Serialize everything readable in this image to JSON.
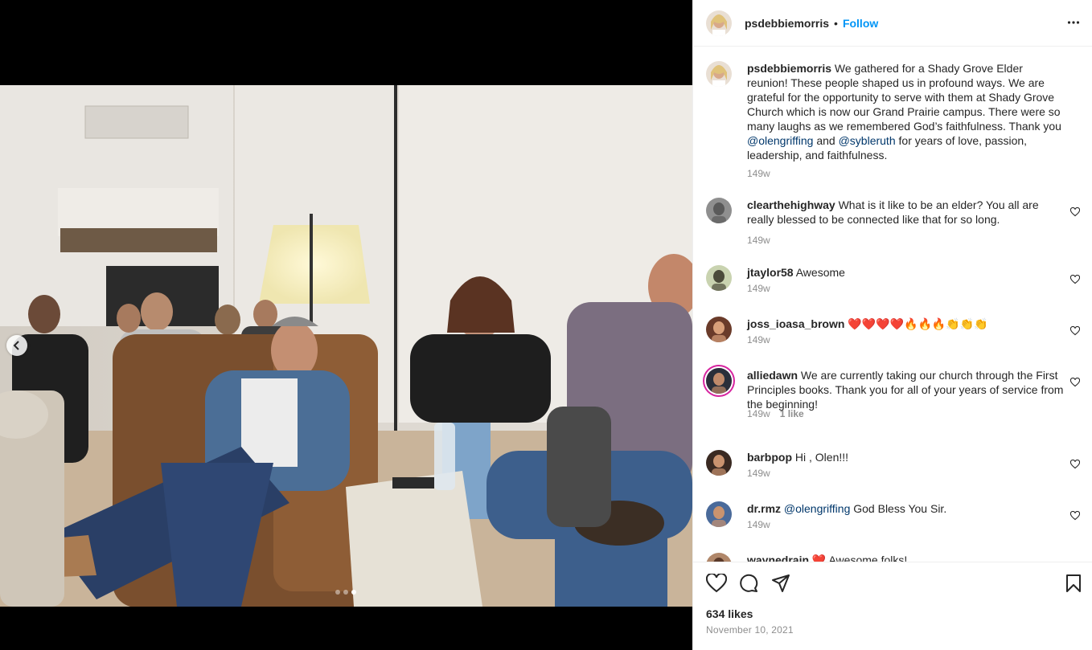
{
  "post": {
    "author": "psdebbiemorris",
    "follow_label": "Follow",
    "separator": "•",
    "caption": "We gathered for a Shady Grove Elder reunion! These people shaped us in profound ways. We are grateful for the opportunity to serve with them at Shady Grove Church which is now our Grand Prairie campus. There were so many laughs as we remembered God’s faithfulness. Thank you",
    "caption_mention_1": "@olengriffing",
    "caption_and": "and",
    "caption_mention_2": "@sybleruth",
    "caption_end": "for years of love, passion, leadership, and faithfulness.",
    "caption_time": "149w",
    "likes": "634 likes",
    "date": "November 10, 2021"
  },
  "carousel": {
    "total": 3,
    "active": 3
  },
  "comments": [
    {
      "user": "clearthehighway",
      "text": "What is it like to be an elder? You all are really blessed to be connected like that for so long.",
      "time": "149w"
    },
    {
      "user": "jtaylor58",
      "text": "Awesome",
      "time": "149w"
    },
    {
      "user": "joss_ioasa_brown",
      "text": "❤️❤️❤️❤️🔥🔥🔥👏👏👏",
      "time": "149w"
    },
    {
      "user": "alliedawn",
      "text": "We are currently taking our church through the First Principles books. Thank you for all of your years of service from the beginning!",
      "time": "149w",
      "likes": "1 like"
    },
    {
      "user": "barbpop",
      "text": "Hi , Olen!!!",
      "time": "149w"
    },
    {
      "user": "dr.rmz",
      "mention": "@olengriffing",
      "text": "God Bless You Sir.",
      "time": "149w"
    },
    {
      "user": "waynedrain",
      "text": "❤️ Awesome folks!",
      "time": ""
    }
  ],
  "icons": {
    "more": "more-options-icon",
    "like": "heart-icon",
    "comment": "comment-icon",
    "share": "paper-plane-icon",
    "save": "bookmark-icon",
    "carousel_prev": "chevron-left-icon"
  },
  "colors": {
    "accent": "#0095f6",
    "mention": "#00376b",
    "muted": "#8e8e8e"
  }
}
